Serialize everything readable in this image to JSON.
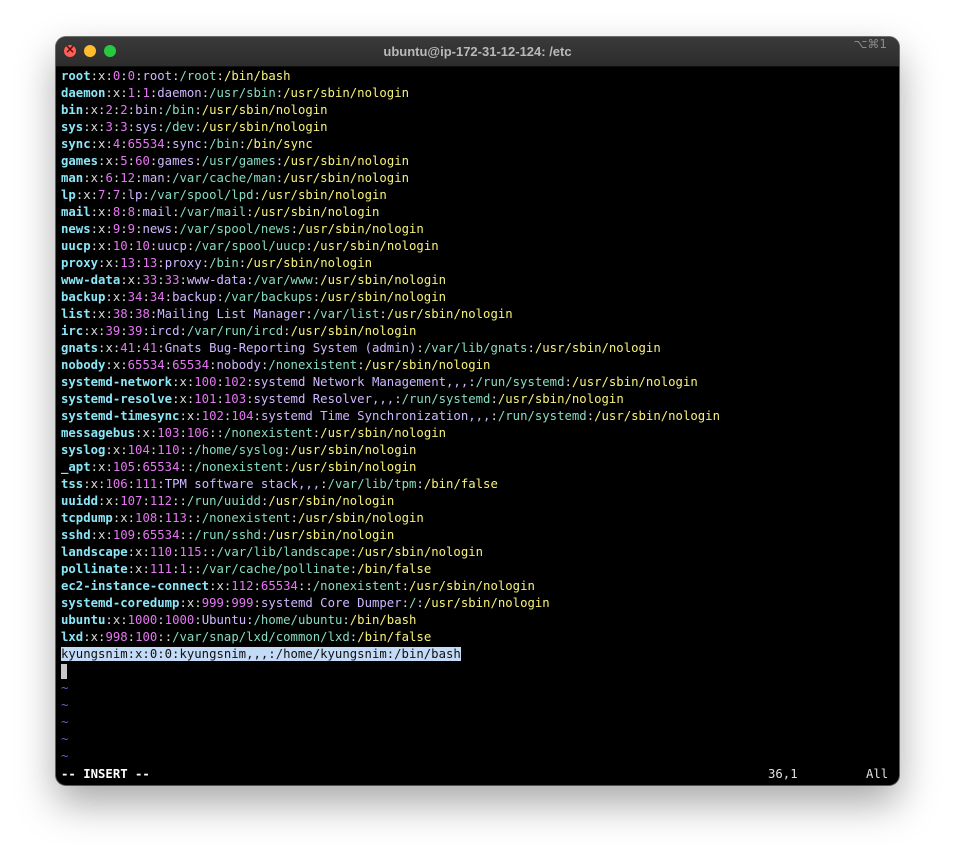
{
  "window": {
    "title": "ubuntu@ip-172-31-12-124: /etc",
    "shortcut": "⌥⌘1",
    "traffic_lights": {
      "close": "#fe5f57",
      "minimize": "#febc2e",
      "maximize": "#28c840"
    }
  },
  "colors": {
    "username": "#8be6f7",
    "uid": "#e776f5",
    "gecos": "#ceb8ff",
    "home": "#88dcc4",
    "shell": "#f8f27a",
    "tilde": "#5f63c9",
    "selection": "#c3dbf6"
  },
  "passwd_lines": [
    {
      "user": "root",
      "pw": "x",
      "uid": "0",
      "gid": "0",
      "gecos": "root",
      "home": "/root",
      "shell": "/bin/bash"
    },
    {
      "user": "daemon",
      "pw": "x",
      "uid": "1",
      "gid": "1",
      "gecos": "daemon",
      "home": "/usr/sbin",
      "shell": "/usr/sbin/nologin"
    },
    {
      "user": "bin",
      "pw": "x",
      "uid": "2",
      "gid": "2",
      "gecos": "bin",
      "home": "/bin",
      "shell": "/usr/sbin/nologin"
    },
    {
      "user": "sys",
      "pw": "x",
      "uid": "3",
      "gid": "3",
      "gecos": "sys",
      "home": "/dev",
      "shell": "/usr/sbin/nologin"
    },
    {
      "user": "sync",
      "pw": "x",
      "uid": "4",
      "gid": "65534",
      "gecos": "sync",
      "home": "/bin",
      "shell": "/bin/sync"
    },
    {
      "user": "games",
      "pw": "x",
      "uid": "5",
      "gid": "60",
      "gecos": "games",
      "home": "/usr/games",
      "shell": "/usr/sbin/nologin"
    },
    {
      "user": "man",
      "pw": "x",
      "uid": "6",
      "gid": "12",
      "gecos": "man",
      "home": "/var/cache/man",
      "shell": "/usr/sbin/nologin"
    },
    {
      "user": "lp",
      "pw": "x",
      "uid": "7",
      "gid": "7",
      "gecos": "lp",
      "home": "/var/spool/lpd",
      "shell": "/usr/sbin/nologin"
    },
    {
      "user": "mail",
      "pw": "x",
      "uid": "8",
      "gid": "8",
      "gecos": "mail",
      "home": "/var/mail",
      "shell": "/usr/sbin/nologin"
    },
    {
      "user": "news",
      "pw": "x",
      "uid": "9",
      "gid": "9",
      "gecos": "news",
      "home": "/var/spool/news",
      "shell": "/usr/sbin/nologin"
    },
    {
      "user": "uucp",
      "pw": "x",
      "uid": "10",
      "gid": "10",
      "gecos": "uucp",
      "home": "/var/spool/uucp",
      "shell": "/usr/sbin/nologin"
    },
    {
      "user": "proxy",
      "pw": "x",
      "uid": "13",
      "gid": "13",
      "gecos": "proxy",
      "home": "/bin",
      "shell": "/usr/sbin/nologin"
    },
    {
      "user": "www-data",
      "pw": "x",
      "uid": "33",
      "gid": "33",
      "gecos": "www-data",
      "home": "/var/www",
      "shell": "/usr/sbin/nologin"
    },
    {
      "user": "backup",
      "pw": "x",
      "uid": "34",
      "gid": "34",
      "gecos": "backup",
      "home": "/var/backups",
      "shell": "/usr/sbin/nologin"
    },
    {
      "user": "list",
      "pw": "x",
      "uid": "38",
      "gid": "38",
      "gecos": "Mailing List Manager",
      "home": "/var/list",
      "shell": "/usr/sbin/nologin"
    },
    {
      "user": "irc",
      "pw": "x",
      "uid": "39",
      "gid": "39",
      "gecos": "ircd",
      "home": "/var/run/ircd",
      "shell": "/usr/sbin/nologin"
    },
    {
      "user": "gnats",
      "pw": "x",
      "uid": "41",
      "gid": "41",
      "gecos": "Gnats Bug-Reporting System (admin)",
      "home": "/var/lib/gnats",
      "shell": "/usr/sbin/nologin"
    },
    {
      "user": "nobody",
      "pw": "x",
      "uid": "65534",
      "gid": "65534",
      "gecos": "nobody",
      "home": "/nonexistent",
      "shell": "/usr/sbin/nologin"
    },
    {
      "user": "systemd-network",
      "pw": "x",
      "uid": "100",
      "gid": "102",
      "gecos": "systemd Network Management,,,",
      "home": "/run/systemd",
      "shell": "/usr/sbin/nologin"
    },
    {
      "user": "systemd-resolve",
      "pw": "x",
      "uid": "101",
      "gid": "103",
      "gecos": "systemd Resolver,,,",
      "home": "/run/systemd",
      "shell": "/usr/sbin/nologin"
    },
    {
      "user": "systemd-timesync",
      "pw": "x",
      "uid": "102",
      "gid": "104",
      "gecos": "systemd Time Synchronization,,,",
      "home": "/run/systemd",
      "shell": "/usr/sbin/nologin"
    },
    {
      "user": "messagebus",
      "pw": "x",
      "uid": "103",
      "gid": "106",
      "gecos": "",
      "home": "/nonexistent",
      "shell": "/usr/sbin/nologin"
    },
    {
      "user": "syslog",
      "pw": "x",
      "uid": "104",
      "gid": "110",
      "gecos": "",
      "home": "/home/syslog",
      "shell": "/usr/sbin/nologin"
    },
    {
      "user": "_apt",
      "pw": "x",
      "uid": "105",
      "gid": "65534",
      "gecos": "",
      "home": "/nonexistent",
      "shell": "/usr/sbin/nologin"
    },
    {
      "user": "tss",
      "pw": "x",
      "uid": "106",
      "gid": "111",
      "gecos": "TPM software stack,,,",
      "home": "/var/lib/tpm",
      "shell": "/bin/false"
    },
    {
      "user": "uuidd",
      "pw": "x",
      "uid": "107",
      "gid": "112",
      "gecos": "",
      "home": "/run/uuidd",
      "shell": "/usr/sbin/nologin"
    },
    {
      "user": "tcpdump",
      "pw": "x",
      "uid": "108",
      "gid": "113",
      "gecos": "",
      "home": "/nonexistent",
      "shell": "/usr/sbin/nologin"
    },
    {
      "user": "sshd",
      "pw": "x",
      "uid": "109",
      "gid": "65534",
      "gecos": "",
      "home": "/run/sshd",
      "shell": "/usr/sbin/nologin"
    },
    {
      "user": "landscape",
      "pw": "x",
      "uid": "110",
      "gid": "115",
      "gecos": "",
      "home": "/var/lib/landscape",
      "shell": "/usr/sbin/nologin"
    },
    {
      "user": "pollinate",
      "pw": "x",
      "uid": "111",
      "gid": "1",
      "gecos": "",
      "home": "/var/cache/pollinate",
      "shell": "/bin/false"
    },
    {
      "user": "ec2-instance-connect",
      "pw": "x",
      "uid": "112",
      "gid": "65534",
      "gecos": "",
      "home": "/nonexistent",
      "shell": "/usr/sbin/nologin"
    },
    {
      "user": "systemd-coredump",
      "pw": "x",
      "uid": "999",
      "gid": "999",
      "gecos": "systemd Core Dumper",
      "home": "/",
      "shell": "/usr/sbin/nologin"
    },
    {
      "user": "ubuntu",
      "pw": "x",
      "uid": "1000",
      "gid": "1000",
      "gecos": "Ubuntu",
      "home": "/home/ubuntu",
      "shell": "/bin/bash"
    },
    {
      "user": "lxd",
      "pw": "x",
      "uid": "998",
      "gid": "100",
      "gecos": "",
      "home": "/var/snap/lxd/common/lxd",
      "shell": "/bin/false"
    }
  ],
  "selected_line": "kyungsnim:x:0:0:kyungsnim,,,:/home/kyungsnim:/bin/bash",
  "empty_line_markers": [
    "~",
    "~",
    "~",
    "~",
    "~"
  ],
  "statusbar": {
    "mode": "-- INSERT --",
    "position": "36,1",
    "scroll": "All"
  }
}
